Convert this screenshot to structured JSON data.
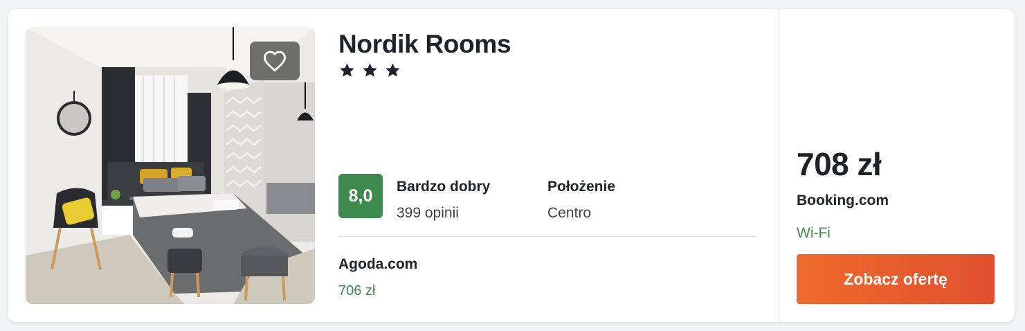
{
  "hotel": {
    "name": "Nordik Rooms",
    "star_rating": 3,
    "photo_description_icon": "hotel-room-photo"
  },
  "rating": {
    "score": "8,0",
    "label": "Bardzo dobry",
    "reviews": "399 opinii"
  },
  "location": {
    "label": "Położenie",
    "value": "Centro"
  },
  "alternative_offer": {
    "provider": "Agoda.com",
    "price": "706 zł"
  },
  "main_offer": {
    "price": "708 zł",
    "provider": "Booking.com",
    "amenity": "Wi-Fi",
    "cta_label": "Zobacz ofertę"
  },
  "icons": {
    "favorite": "heart-icon",
    "star": "star-icon"
  },
  "colors": {
    "score_badge": "#3e8a4e",
    "price_green": "#3e8a4e",
    "cta_start": "#ee6a2c",
    "cta_end": "#e0502d"
  }
}
